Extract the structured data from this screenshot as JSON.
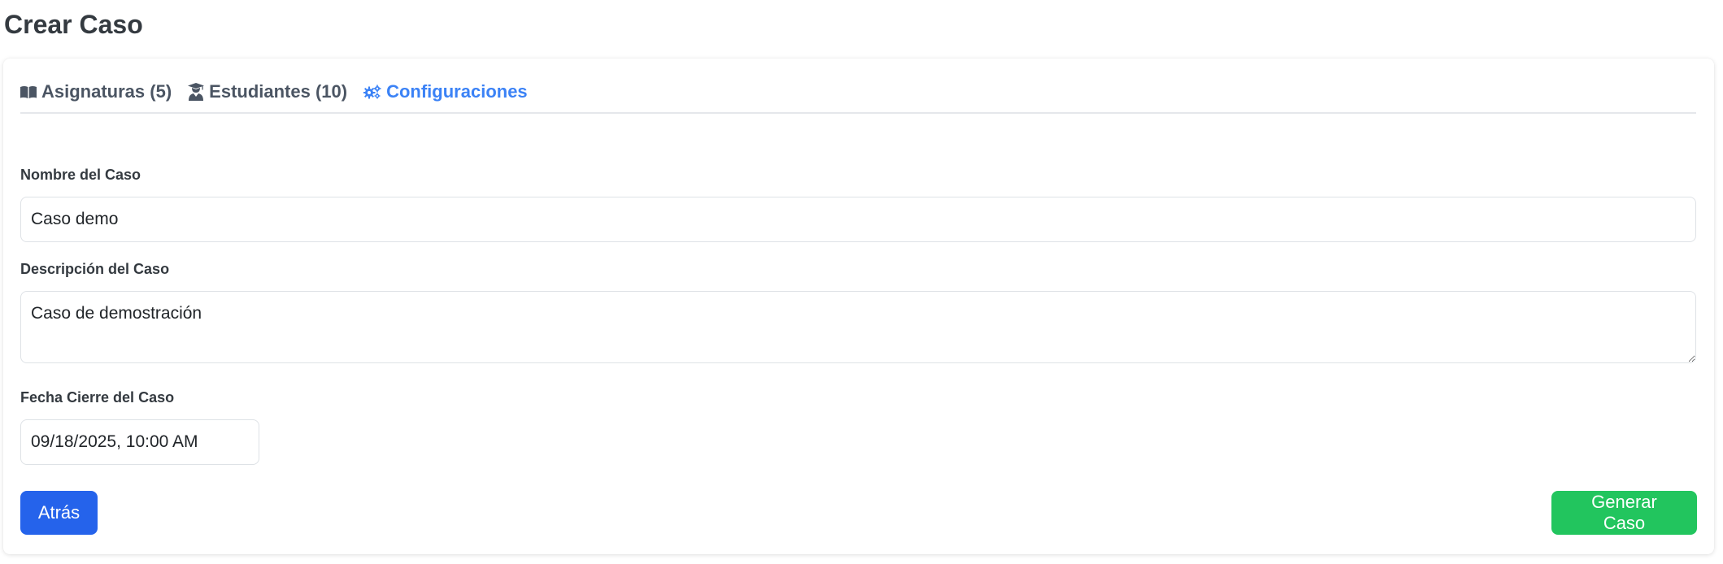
{
  "page": {
    "title": "Crear Caso"
  },
  "tabs": [
    {
      "label": "Asignaturas (5)",
      "icon": "book-open-icon",
      "active": false
    },
    {
      "label": "Estudiantes (10)",
      "icon": "user-graduate-icon",
      "active": false
    },
    {
      "label": "Configuraciones",
      "icon": "cogs-icon",
      "active": true
    }
  ],
  "form": {
    "name": {
      "label": "Nombre del Caso",
      "value": "Caso demo"
    },
    "description": {
      "label": "Descripción del Caso",
      "value": "Caso de demostración"
    },
    "close_date": {
      "label": "Fecha Cierre del Caso",
      "value": "09/18/2025, 10:00 AM"
    }
  },
  "buttons": {
    "back_label": "Atrás",
    "generate_label": "Generar Caso"
  },
  "colors": {
    "active_tab": "#3b82f6",
    "back_button": "#2563eb",
    "generate_button": "#22c55e"
  }
}
